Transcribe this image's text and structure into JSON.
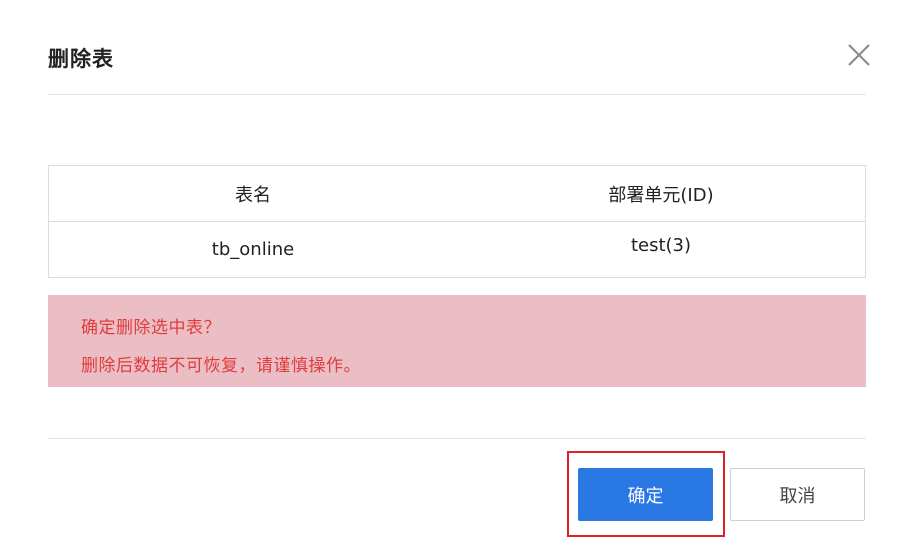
{
  "dialog": {
    "title": "删除表",
    "close_icon": "close-icon"
  },
  "table": {
    "headers": [
      "表名",
      "部署单元(ID)"
    ],
    "rows": [
      [
        "tb_online",
        "test(3)"
      ]
    ]
  },
  "warning": {
    "line1": "确定删除选中表？",
    "line2": "删除后数据不可恢复，请谨慎操作。",
    "text_color": "#e03c3c",
    "bg_color": "#ebbec6"
  },
  "footer": {
    "confirm_label": "确定",
    "cancel_label": "取消",
    "confirm_color": "#2a78e4",
    "highlight_color": "#e0202a"
  }
}
